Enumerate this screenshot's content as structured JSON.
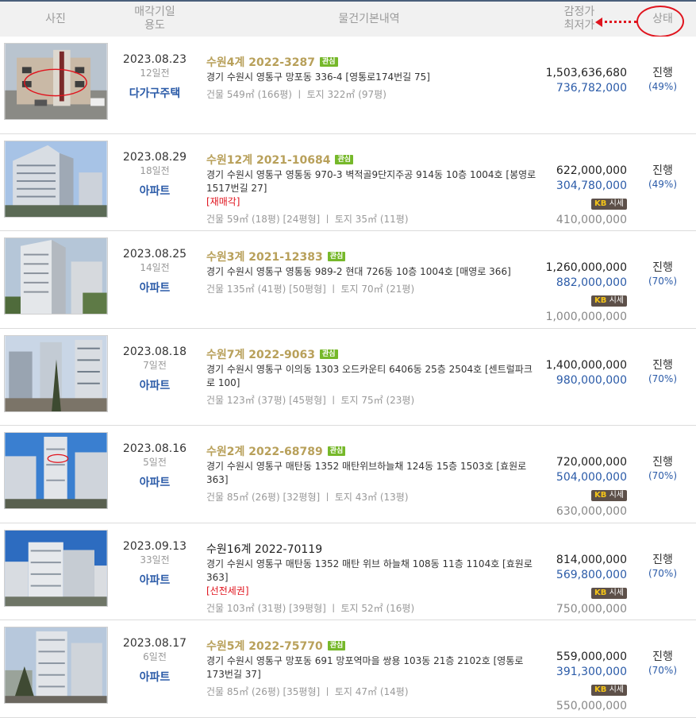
{
  "header": {
    "photo": "사진",
    "date_line1": "매각기일",
    "date_line2": "용도",
    "info": "물건기본내역",
    "price_line1": "감정가",
    "price_line2": "최저가",
    "status": "상태"
  },
  "colors": {
    "accent_red": "#e0141e",
    "link_blue": "#2b5ba8",
    "case_gold": "#b8a05a",
    "badge_green": "#76b82a"
  },
  "rows": [
    {
      "date": "2023.08.23",
      "days": "12일전",
      "use": "다가구주택",
      "case": "수원4계 2022-3287",
      "badge": "관심",
      "addr": "경기 수원시 영통구 망포동 336-4 [영통로174번길 75]",
      "tag": "",
      "area": "건물 549㎡ (166평)  ㅣ  토지 322㎡ (97평)",
      "appraised": "1,503,636,680",
      "minimum": "736,782,000",
      "sise": "",
      "market": "",
      "status": "진행",
      "pct": "(49%)"
    },
    {
      "date": "2023.08.29",
      "days": "18일전",
      "use": "아파트",
      "case": "수원12계 2021-10684",
      "badge": "관심",
      "addr": "경기 수원시 영통구 영통동 970-3 벽적골9단지주공 914동 10층 1004호 [봉영로1517번길 27]",
      "tag": "[재매각]",
      "area": "건물 59㎡ (18평) [24평형]  ㅣ  토지 35㎡ (11평)",
      "appraised": "622,000,000",
      "minimum": "304,780,000",
      "sise": "시세",
      "market": "410,000,000",
      "status": "진행",
      "pct": "(49%)"
    },
    {
      "date": "2023.08.25",
      "days": "14일전",
      "use": "아파트",
      "case": "수원3계 2021-12383",
      "badge": "관심",
      "addr": "경기 수원시 영통구 영통동 989-2 현대 726동 10층 1004호 [매영로 366]",
      "tag": "",
      "area": "건물 135㎡ (41평) [50평형]  ㅣ  토지 70㎡ (21평)",
      "appraised": "1,260,000,000",
      "minimum": "882,000,000",
      "sise": "시세",
      "market": "1,000,000,000",
      "status": "진행",
      "pct": "(70%)"
    },
    {
      "date": "2023.08.18",
      "days": "7일전",
      "use": "아파트",
      "case": "수원7계 2022-9063",
      "badge": "관심",
      "addr": "경기 수원시 영통구 이의동 1303 오드카운티 6406동 25층 2504호 [센트럴파크로 100]",
      "tag": "",
      "area": "건물 123㎡ (37평) [45평형]  ㅣ  토지 75㎡ (23평)",
      "appraised": "1,400,000,000",
      "minimum": "980,000,000",
      "sise": "",
      "market": "",
      "status": "진행",
      "pct": "(70%)"
    },
    {
      "date": "2023.08.16",
      "days": "5일전",
      "use": "아파트",
      "case": "수원2계 2022-68789",
      "badge": "관심",
      "addr": "경기 수원시 영통구 매탄동 1352 매탄위브하늘채 124동 15층 1503호 [효원로 363]",
      "tag": "",
      "area": "건물 85㎡ (26평) [32평형]  ㅣ  토지 43㎡ (13평)",
      "appraised": "720,000,000",
      "minimum": "504,000,000",
      "sise": "시세",
      "market": "630,000,000",
      "status": "진행",
      "pct": "(70%)"
    },
    {
      "date": "2023.09.13",
      "days": "33일전",
      "use": "아파트",
      "case": "수원16계 2022-70119",
      "badge": "",
      "addr": "경기 수원시 영통구 매탄동 1352 매탄 위브 하늘채 108동 11층 1104호 [효원로 363]",
      "tag": "[선전세권]",
      "area": "건물 103㎡ (31평) [39평형]  ㅣ  토지 52㎡ (16평)",
      "appraised": "814,000,000",
      "minimum": "569,800,000",
      "sise": "시세",
      "market": "750,000,000",
      "status": "진행",
      "pct": "(70%)"
    },
    {
      "date": "2023.08.17",
      "days": "6일전",
      "use": "아파트",
      "case": "수원5계 2022-75770",
      "badge": "관심",
      "addr": "경기 수원시 영통구 망포동 691 망포역마을 쌍용 103동 21층 2102호 [영통로173번길 37]",
      "tag": "",
      "area": "건물 85㎡ (26평) [35평형]  ㅣ  토지 47㎡ (14평)",
      "appraised": "559,000,000",
      "minimum": "391,300,000",
      "sise": "시세",
      "market": "550,000,000",
      "status": "진행",
      "pct": "(70%)"
    }
  ]
}
